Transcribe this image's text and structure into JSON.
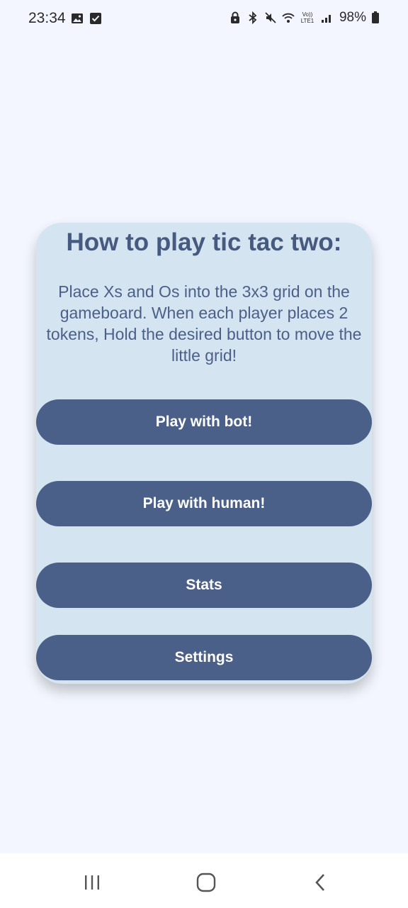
{
  "status_bar": {
    "time": "23:34",
    "left_icons": [
      "image-icon",
      "checkbox-icon"
    ],
    "right_icons": [
      "lock-icon",
      "bluetooth-icon",
      "mute-icon",
      "wifi-icon",
      "volte-icon",
      "signal-icon"
    ],
    "battery": "98%",
    "volte_label": "Vo)) LTE1"
  },
  "card": {
    "title": "How to play tic tac two:",
    "body": "Place Xs and Os into the 3x3 grid on the gameboard. When each player places 2 tokens, Hold the desired button to move the little grid!"
  },
  "buttons": {
    "play_bot": "Play with bot!",
    "play_human": "Play with human!",
    "stats": "Stats",
    "settings": "Settings"
  },
  "colors": {
    "background": "#f3f6fe",
    "card": "#d5e4f1",
    "button": "#4b6089",
    "title_text": "#465a80"
  },
  "nav_bar": {
    "items": [
      "recents-icon",
      "home-icon",
      "back-icon"
    ]
  }
}
